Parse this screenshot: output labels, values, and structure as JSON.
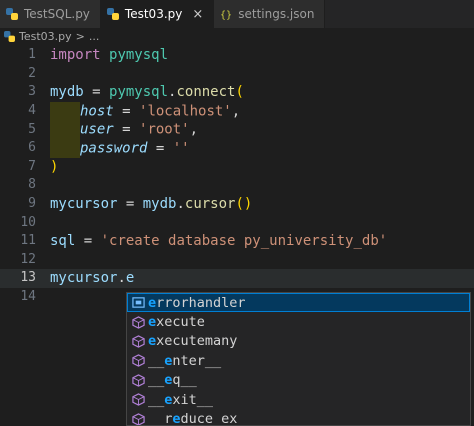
{
  "tabs": [
    {
      "label": "TestSQL.py",
      "icon": "python-icon",
      "active": false
    },
    {
      "label": "Test03.py",
      "icon": "python-icon",
      "active": true,
      "close": "×"
    },
    {
      "label": "settings.json",
      "icon": "json-icon",
      "active": false
    }
  ],
  "breadcrumb": {
    "file": "Test03.py",
    "separator": ">",
    "more": "..."
  },
  "lines": [
    {
      "n": "1",
      "tokens": [
        [
          "kw",
          "import"
        ],
        [
          "op",
          " "
        ],
        [
          "mod",
          "pymysql"
        ]
      ]
    },
    {
      "n": "2",
      "tokens": []
    },
    {
      "n": "3",
      "tokens": [
        [
          "id",
          "mydb"
        ],
        [
          "op",
          " = "
        ],
        [
          "mod",
          "pymysql"
        ],
        [
          "op",
          "."
        ],
        [
          "fn",
          "connect"
        ],
        [
          "br",
          "("
        ]
      ]
    },
    {
      "n": "4",
      "indent": true,
      "tokens": [
        [
          "param",
          "host"
        ],
        [
          "op",
          " = "
        ],
        [
          "str",
          "'localhost'"
        ],
        [
          "op",
          ","
        ]
      ]
    },
    {
      "n": "5",
      "indent": true,
      "tokens": [
        [
          "param",
          "user"
        ],
        [
          "op",
          " = "
        ],
        [
          "str",
          "'root'"
        ],
        [
          "op",
          ","
        ]
      ]
    },
    {
      "n": "6",
      "indent": true,
      "tokens": [
        [
          "param",
          "password"
        ],
        [
          "op",
          " = "
        ],
        [
          "str",
          "''"
        ]
      ]
    },
    {
      "n": "7",
      "tokens": [
        [
          "br",
          ")"
        ]
      ]
    },
    {
      "n": "8",
      "tokens": []
    },
    {
      "n": "9",
      "tokens": [
        [
          "id",
          "mycursor"
        ],
        [
          "op",
          " = "
        ],
        [
          "id",
          "mydb"
        ],
        [
          "op",
          "."
        ],
        [
          "fn",
          "cursor"
        ],
        [
          "br",
          "()"
        ]
      ]
    },
    {
      "n": "10",
      "tokens": []
    },
    {
      "n": "11",
      "tokens": [
        [
          "id",
          "sql"
        ],
        [
          "op",
          " = "
        ],
        [
          "str",
          "'create database py_university_db'"
        ]
      ]
    },
    {
      "n": "12",
      "tokens": []
    },
    {
      "n": "13",
      "current": true,
      "tokens": [
        [
          "id",
          "mycursor"
        ],
        [
          "op",
          "."
        ],
        [
          "id",
          "e"
        ]
      ]
    },
    {
      "n": "14",
      "tokens": []
    }
  ],
  "suggestions": [
    {
      "label": "errorhandler",
      "kind": "field-icon",
      "selected": true
    },
    {
      "label": "execute",
      "kind": "method-icon",
      "selected": false
    },
    {
      "label": "executemany",
      "kind": "method-icon",
      "selected": false
    },
    {
      "label": "__enter__",
      "kind": "method-icon",
      "selected": false
    },
    {
      "label": "__eq__",
      "kind": "method-icon",
      "selected": false
    },
    {
      "label": "__exit__",
      "kind": "method-icon",
      "selected": false
    },
    {
      "label": "__reduce_ex__",
      "kind": "method-icon",
      "selected": false
    }
  ],
  "match_query": "e",
  "colors": {
    "background": "#1e1e1e",
    "keyword": "#c586c0",
    "string": "#ce9178",
    "function": "#dcdcaa",
    "variable": "#9cdcfe",
    "match": "#18a3ff",
    "method_icon": "#b180d7",
    "selection": "#04395e"
  }
}
